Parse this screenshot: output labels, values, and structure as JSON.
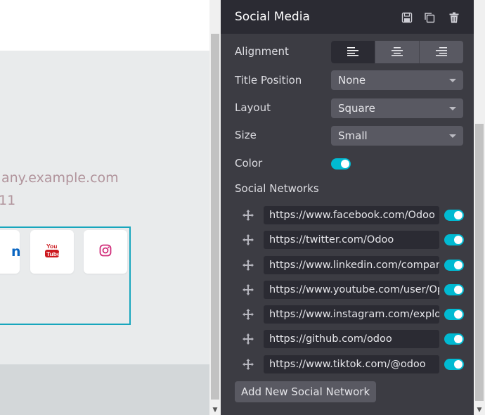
{
  "canvas": {
    "email_partial": "any.example.com",
    "phone_partial": "11",
    "linkedin_partial": "n",
    "youtube_icon": "youtube-icon",
    "instagram_icon": "instagram-icon"
  },
  "panel": {
    "title": "Social Media",
    "header_icons": [
      "save-icon",
      "duplicate-icon",
      "trash-icon"
    ],
    "alignment": {
      "label": "Alignment",
      "options": [
        "align-left-icon",
        "align-center-icon",
        "align-right-icon"
      ],
      "active": "align-left-icon"
    },
    "title_position": {
      "label": "Title Position",
      "value": "None"
    },
    "layout": {
      "label": "Layout",
      "value": "Square"
    },
    "size": {
      "label": "Size",
      "value": "Small"
    },
    "color": {
      "label": "Color",
      "enabled": true
    },
    "social_networks": {
      "label": "Social Networks",
      "items": [
        {
          "url": "https://www.facebook.com/Odoo",
          "enabled": true
        },
        {
          "url": "https://twitter.com/Odoo",
          "enabled": true
        },
        {
          "url": "https://www.linkedin.com/company/odoo",
          "enabled": true
        },
        {
          "url": "https://www.youtube.com/user/OpenERPonline",
          "enabled": true
        },
        {
          "url": "https://www.instagram.com/explore/tags/odoo/",
          "enabled": true
        },
        {
          "url": "https://github.com/odoo",
          "enabled": true
        },
        {
          "url": "https://www.tiktok.com/@odoo",
          "enabled": true
        }
      ]
    },
    "add_button": "Add New Social Network"
  },
  "colors": {
    "accent": "#01bad2",
    "panel_bg": "#3c3c43",
    "header_bg": "#2b2b33",
    "frame_border": "#18a6bd"
  }
}
